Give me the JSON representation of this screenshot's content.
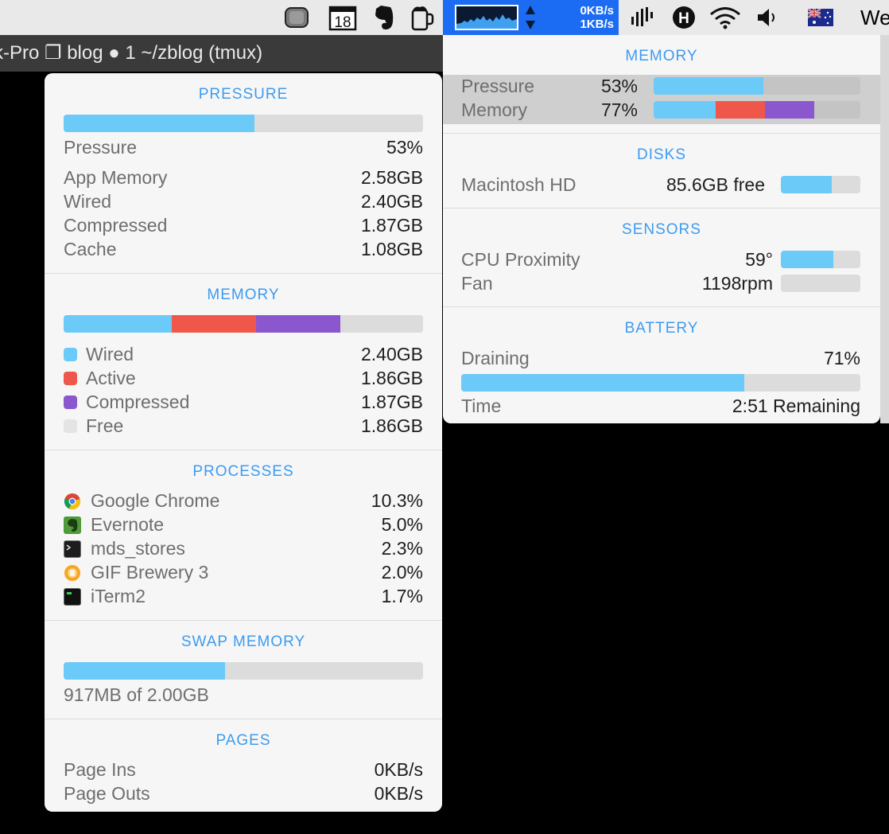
{
  "menubar": {
    "calendar_day": "18",
    "net_down": "0KB/s",
    "net_up": "1KB/s",
    "cut_text": "We"
  },
  "terminal": {
    "title": "k-Pro ❐ blog ● 1 ~/zblog (tmux)"
  },
  "colors": {
    "blue": "#6ccaf8",
    "red": "#ef574b",
    "purple": "#8b57ce",
    "free": "#e4e4e4",
    "header": "#3d9bf0"
  },
  "left": {
    "pressure": {
      "header": "PRESSURE",
      "bar_fraction": 0.53,
      "label": "Pressure",
      "value": "53%",
      "rows": [
        {
          "label": "App Memory",
          "value": "2.58GB"
        },
        {
          "label": "Wired",
          "value": "2.40GB"
        },
        {
          "label": "Compressed",
          "value": "1.87GB"
        },
        {
          "label": "Cache",
          "value": "1.08GB"
        }
      ]
    },
    "memory": {
      "header": "MEMORY",
      "rows": [
        {
          "label": "Wired",
          "value": "2.40GB",
          "color": "#6ccaf8"
        },
        {
          "label": "Active",
          "value": "1.86GB",
          "color": "#ef574b"
        },
        {
          "label": "Compressed",
          "value": "1.87GB",
          "color": "#8b57ce"
        },
        {
          "label": "Free",
          "value": "1.86GB",
          "color": "#e4e4e4"
        }
      ]
    },
    "processes": {
      "header": "PROCESSES",
      "rows": [
        {
          "name": "Google Chrome",
          "value": "10.3%",
          "icon": "chrome-icon"
        },
        {
          "name": "Evernote",
          "value": "5.0%",
          "icon": "evernote-icon"
        },
        {
          "name": "mds_stores",
          "value": "2.3%",
          "icon": "terminal-icon"
        },
        {
          "name": "GIF Brewery 3",
          "value": "2.0%",
          "icon": "gif-brewery-icon"
        },
        {
          "name": "iTerm2",
          "value": "1.7%",
          "icon": "iterm-icon"
        }
      ]
    },
    "swap": {
      "header": "SWAP MEMORY",
      "bar_fraction": 0.45,
      "text": "917MB of 2.00GB"
    },
    "pages": {
      "header": "PAGES",
      "rows": [
        {
          "label": "Page Ins",
          "value": "0KB/s"
        },
        {
          "label": "Page Outs",
          "value": "0KB/s"
        }
      ]
    }
  },
  "right": {
    "memory": {
      "header": "MEMORY",
      "pressure_label": "Pressure",
      "pressure_value": "53%",
      "memory_label": "Memory",
      "memory_value": "77%"
    },
    "disks": {
      "header": "DISKS",
      "label": "Macintosh HD",
      "value": "85.6GB free",
      "bar_fraction": 0.64
    },
    "sensors": {
      "header": "SENSORS",
      "cpu_label": "CPU Proximity",
      "cpu_value": "59°",
      "cpu_fraction": 0.66,
      "fan_label": "Fan",
      "fan_value": "1198rpm",
      "fan_fraction": 0.0
    },
    "battery": {
      "header": "BATTERY",
      "status": "Draining",
      "percent": "71%",
      "bar_fraction": 0.71,
      "time_label": "Time",
      "time_value": "2:51 Remaining"
    }
  }
}
